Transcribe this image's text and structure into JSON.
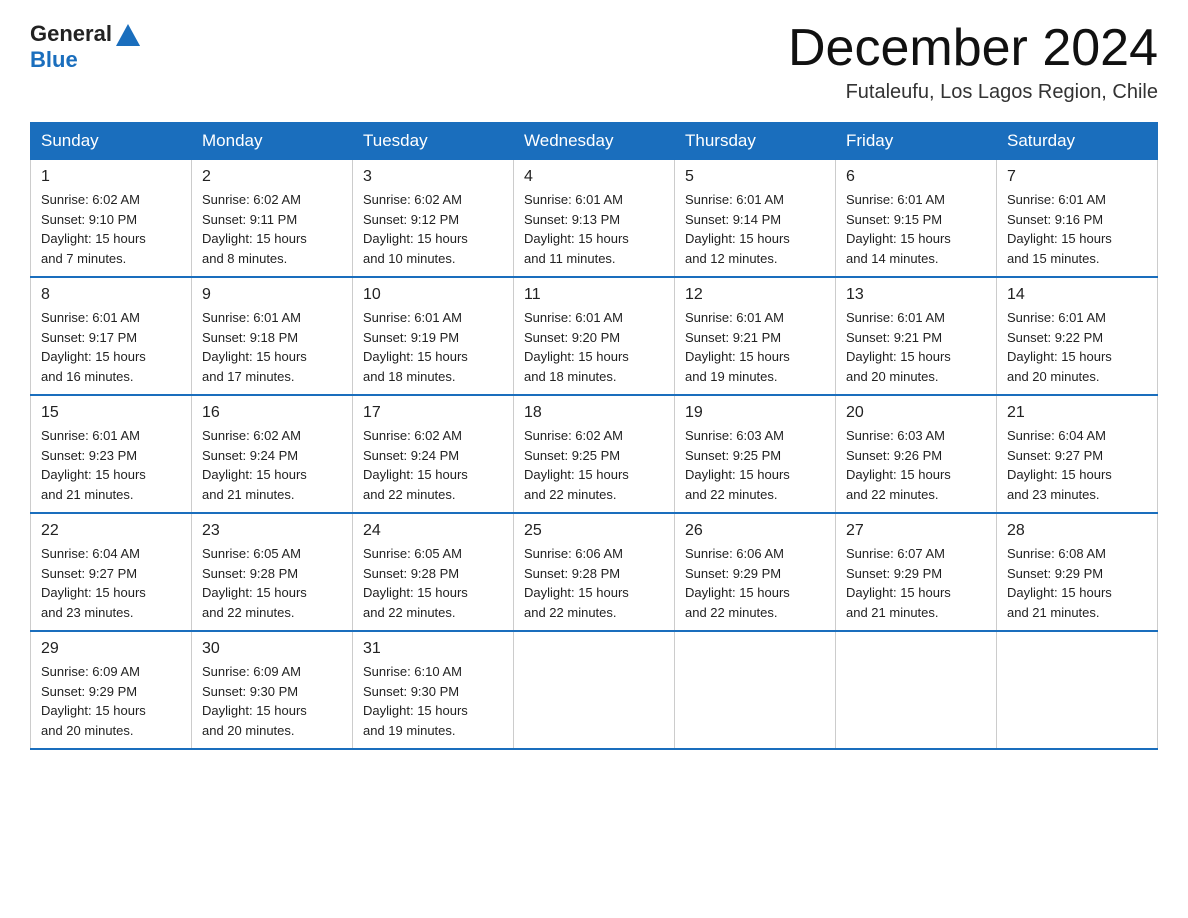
{
  "header": {
    "logo_general": "General",
    "logo_blue": "Blue",
    "title": "December 2024",
    "subtitle": "Futaleufu, Los Lagos Region, Chile"
  },
  "weekdays": [
    "Sunday",
    "Monday",
    "Tuesday",
    "Wednesday",
    "Thursday",
    "Friday",
    "Saturday"
  ],
  "weeks": [
    [
      {
        "day": "1",
        "sunrise": "6:02 AM",
        "sunset": "9:10 PM",
        "daylight": "15 hours and 7 minutes."
      },
      {
        "day": "2",
        "sunrise": "6:02 AM",
        "sunset": "9:11 PM",
        "daylight": "15 hours and 8 minutes."
      },
      {
        "day": "3",
        "sunrise": "6:02 AM",
        "sunset": "9:12 PM",
        "daylight": "15 hours and 10 minutes."
      },
      {
        "day": "4",
        "sunrise": "6:01 AM",
        "sunset": "9:13 PM",
        "daylight": "15 hours and 11 minutes."
      },
      {
        "day": "5",
        "sunrise": "6:01 AM",
        "sunset": "9:14 PM",
        "daylight": "15 hours and 12 minutes."
      },
      {
        "day": "6",
        "sunrise": "6:01 AM",
        "sunset": "9:15 PM",
        "daylight": "15 hours and 14 minutes."
      },
      {
        "day": "7",
        "sunrise": "6:01 AM",
        "sunset": "9:16 PM",
        "daylight": "15 hours and 15 minutes."
      }
    ],
    [
      {
        "day": "8",
        "sunrise": "6:01 AM",
        "sunset": "9:17 PM",
        "daylight": "15 hours and 16 minutes."
      },
      {
        "day": "9",
        "sunrise": "6:01 AM",
        "sunset": "9:18 PM",
        "daylight": "15 hours and 17 minutes."
      },
      {
        "day": "10",
        "sunrise": "6:01 AM",
        "sunset": "9:19 PM",
        "daylight": "15 hours and 18 minutes."
      },
      {
        "day": "11",
        "sunrise": "6:01 AM",
        "sunset": "9:20 PM",
        "daylight": "15 hours and 18 minutes."
      },
      {
        "day": "12",
        "sunrise": "6:01 AM",
        "sunset": "9:21 PM",
        "daylight": "15 hours and 19 minutes."
      },
      {
        "day": "13",
        "sunrise": "6:01 AM",
        "sunset": "9:21 PM",
        "daylight": "15 hours and 20 minutes."
      },
      {
        "day": "14",
        "sunrise": "6:01 AM",
        "sunset": "9:22 PM",
        "daylight": "15 hours and 20 minutes."
      }
    ],
    [
      {
        "day": "15",
        "sunrise": "6:01 AM",
        "sunset": "9:23 PM",
        "daylight": "15 hours and 21 minutes."
      },
      {
        "day": "16",
        "sunrise": "6:02 AM",
        "sunset": "9:24 PM",
        "daylight": "15 hours and 21 minutes."
      },
      {
        "day": "17",
        "sunrise": "6:02 AM",
        "sunset": "9:24 PM",
        "daylight": "15 hours and 22 minutes."
      },
      {
        "day": "18",
        "sunrise": "6:02 AM",
        "sunset": "9:25 PM",
        "daylight": "15 hours and 22 minutes."
      },
      {
        "day": "19",
        "sunrise": "6:03 AM",
        "sunset": "9:25 PM",
        "daylight": "15 hours and 22 minutes."
      },
      {
        "day": "20",
        "sunrise": "6:03 AM",
        "sunset": "9:26 PM",
        "daylight": "15 hours and 22 minutes."
      },
      {
        "day": "21",
        "sunrise": "6:04 AM",
        "sunset": "9:27 PM",
        "daylight": "15 hours and 23 minutes."
      }
    ],
    [
      {
        "day": "22",
        "sunrise": "6:04 AM",
        "sunset": "9:27 PM",
        "daylight": "15 hours and 23 minutes."
      },
      {
        "day": "23",
        "sunrise": "6:05 AM",
        "sunset": "9:28 PM",
        "daylight": "15 hours and 22 minutes."
      },
      {
        "day": "24",
        "sunrise": "6:05 AM",
        "sunset": "9:28 PM",
        "daylight": "15 hours and 22 minutes."
      },
      {
        "day": "25",
        "sunrise": "6:06 AM",
        "sunset": "9:28 PM",
        "daylight": "15 hours and 22 minutes."
      },
      {
        "day": "26",
        "sunrise": "6:06 AM",
        "sunset": "9:29 PM",
        "daylight": "15 hours and 22 minutes."
      },
      {
        "day": "27",
        "sunrise": "6:07 AM",
        "sunset": "9:29 PM",
        "daylight": "15 hours and 21 minutes."
      },
      {
        "day": "28",
        "sunrise": "6:08 AM",
        "sunset": "9:29 PM",
        "daylight": "15 hours and 21 minutes."
      }
    ],
    [
      {
        "day": "29",
        "sunrise": "6:09 AM",
        "sunset": "9:29 PM",
        "daylight": "15 hours and 20 minutes."
      },
      {
        "day": "30",
        "sunrise": "6:09 AM",
        "sunset": "9:30 PM",
        "daylight": "15 hours and 20 minutes."
      },
      {
        "day": "31",
        "sunrise": "6:10 AM",
        "sunset": "9:30 PM",
        "daylight": "15 hours and 19 minutes."
      },
      null,
      null,
      null,
      null
    ]
  ],
  "labels": {
    "sunrise_prefix": "Sunrise: ",
    "sunset_prefix": "Sunset: ",
    "daylight_prefix": "Daylight: "
  }
}
